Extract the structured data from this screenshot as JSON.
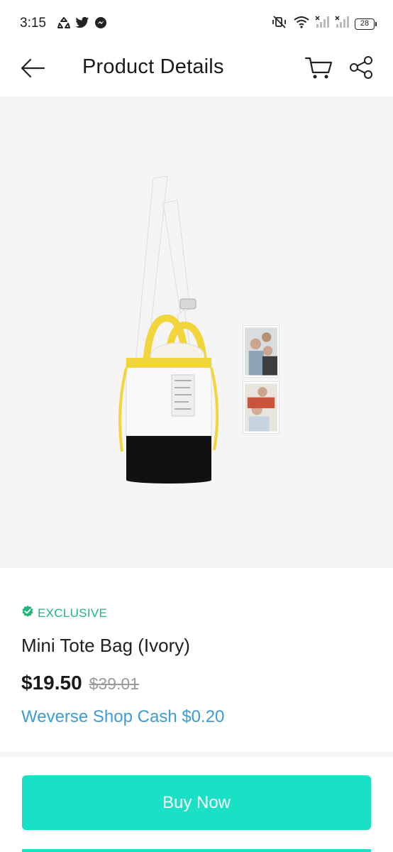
{
  "status_bar": {
    "time": "3:15",
    "battery": "28",
    "left_icons": [
      "sync-icon",
      "twitter-icon",
      "messenger-icon"
    ],
    "right_icons": [
      "vibrate-off-icon",
      "wifi-icon",
      "signal-icon",
      "signal-icon"
    ]
  },
  "header": {
    "title": "Product Details",
    "back_icon": "arrow-left-icon",
    "cart_icon": "cart-icon",
    "share_icon": "share-icon"
  },
  "product": {
    "badge": "EXCLUSIVE",
    "badge_icon": "verified-check-icon",
    "name": "Mini Tote Bag (Ivory)",
    "price": "$19.50",
    "original_price": "$39.01",
    "cash": "Weverse Shop Cash $0.20"
  },
  "actions": {
    "buy_now": "Buy Now"
  },
  "colors": {
    "accent": "#18e1c5",
    "exclusive_green": "#1fb87a",
    "cash_blue": "#3d9bd6",
    "image_bg": "#f5f5f5"
  }
}
